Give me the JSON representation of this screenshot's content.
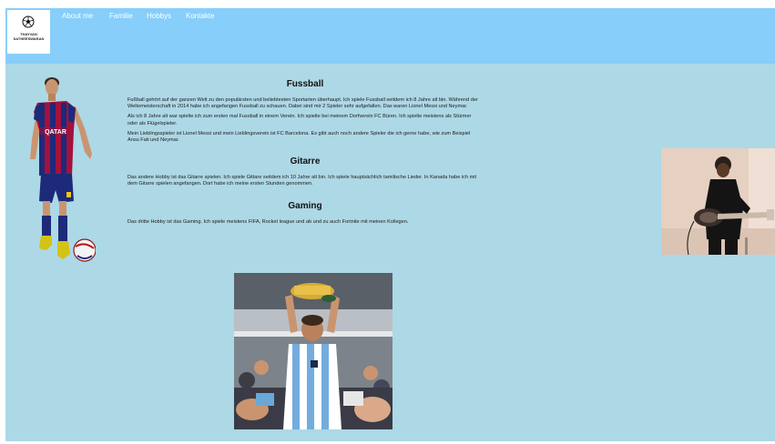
{
  "logo": {
    "icon": "soccer-ball-icon",
    "line1": "THAYVAN",
    "line2": "SATHEESWARAN"
  },
  "nav": {
    "items": [
      {
        "label": "About me"
      },
      {
        "label": "Familie"
      },
      {
        "label": "Hobbys"
      },
      {
        "label": "Kontakte"
      }
    ]
  },
  "sections": {
    "fussball": {
      "title": "Fussball",
      "paragraphs": [
        "Fußball gehört auf der ganzen Welt zu den populärsten und beliebtesten Sportarten überhaupt. Ich spiele Fussball seitdem ich 8 Jahre alt bin. Während der Weltemeisterschaft in 2014 habe ich angefangen Fussball zu schauen. Dabei sind mir 2 Spieler sehr aufgefallen. Das waren Lionel Messi und Neymar.",
        "Als ich 8 Jahre alt war spielte ich zum ersten mal Fussball in einem Verein. Ich spielte bei meinem Dorfverein FC Büren. Ich spielte meistens als Stürmer oder als Flügelspieler.",
        "Mein Lieblingsspieler ist Lionel Messi und mein Lieblingsverein ist FC Barcelona. Es gibt auch noch andere Spieler die ich gerne habe, wie zum Beispiel Ansu Fati und Neymar."
      ]
    },
    "gitarre": {
      "title": "Gitarre",
      "paragraphs": [
        "Das andere Hobby ist das Gitarre spielen. Ich spiele Gittare seitdem ich 10 Jahre alt bin. Ich spiele hauptsächlich tamilische Lieder. In Kanada habe ich mit dem Gitarre spielen angefangen. Dort habe ich meine ersten Stunden genommen."
      ]
    },
    "gaming": {
      "title": "Gaming",
      "paragraphs": [
        "Das dritte Hobby ist das Gaming. Ich spiele meistens FIFA, Rocket league und ab und zu auch Fortnite mit meinen Kollegen."
      ]
    }
  },
  "images": {
    "messi_left": {
      "content": "Messi im Barcelona-Trikot (QATAR) mit Ball"
    },
    "guitar_right": {
      "content": "Person spielt E-Gitarre"
    },
    "messi_trophy": {
      "content": "Messi mit WM-Pokal im Argentinien-Trikot"
    }
  }
}
